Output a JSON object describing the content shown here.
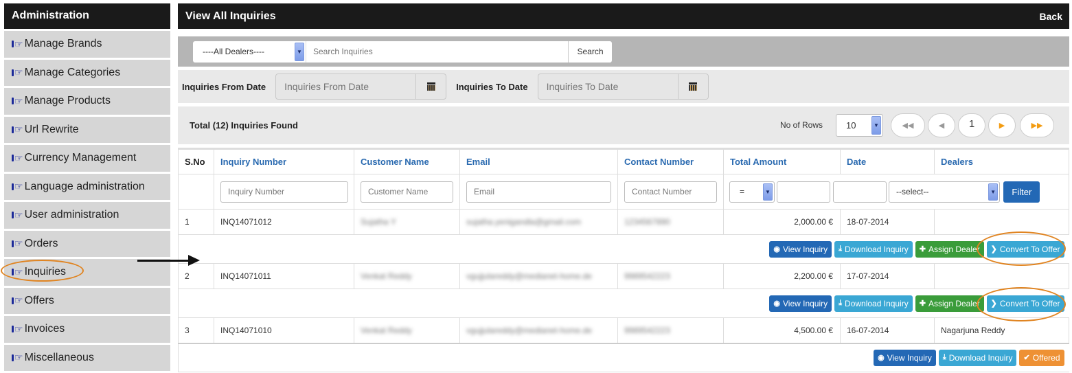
{
  "sidebar": {
    "title": "Administration",
    "items": [
      {
        "label": "Manage Brands"
      },
      {
        "label": "Manage Categories"
      },
      {
        "label": "Manage Products"
      },
      {
        "label": "Url Rewrite"
      },
      {
        "label": "Currency Management"
      },
      {
        "label": "Language administration"
      },
      {
        "label": "User administration"
      },
      {
        "label": "Orders"
      },
      {
        "label": "Inquiries"
      },
      {
        "label": "Offers"
      },
      {
        "label": "Invoices"
      },
      {
        "label": "Miscellaneous"
      }
    ],
    "highlighted_item": "Inquiries"
  },
  "header": {
    "title": "View All Inquiries",
    "back_label": "Back"
  },
  "search": {
    "dealer_select_value": "----All Dealers----",
    "placeholder": "Search Inquiries",
    "button_label": "Search"
  },
  "dates": {
    "from_label": "Inquiries From Date",
    "from_placeholder": "Inquiries From Date",
    "to_label": "Inquiries To Date",
    "to_placeholder": "Inquiries To Date"
  },
  "info": {
    "total_text": "Total (12) Inquiries Found",
    "rows_label": "No of Rows",
    "rows_value": "10",
    "current_page": "1",
    "pager_icons": [
      "first-page-icon",
      "prev-page-icon",
      "next-page-icon",
      "last-page-icon"
    ]
  },
  "table": {
    "headers": [
      "S.No",
      "Inquiry Number",
      "Customer Name",
      "Email",
      "Contact Number",
      "Total Amount",
      "Date",
      "Dealers"
    ],
    "filters": {
      "inquiry_number_placeholder": "Inquiry Number",
      "customer_name_placeholder": "Customer Name",
      "email_placeholder": "Email",
      "contact_number_placeholder": "Contact Number",
      "amount_operator": "=",
      "dealer_select_value": "--select--",
      "filter_button": "Filter"
    },
    "rows": [
      {
        "sno": "1",
        "inquiry_number": "INQ14071012",
        "customer_name": "Sujatha Y",
        "email": "sujatha.yenigandla@gmail.com",
        "contact": "1234567890",
        "amount": "2,000.00 €",
        "date": "18-07-2014",
        "dealer": "",
        "actions": [
          "View Inquiry",
          "Download Inquiry",
          "Assign Dealer",
          "Convert To Offer"
        ]
      },
      {
        "sno": "2",
        "inquiry_number": "INQ14071011",
        "customer_name": "Venkat Reddy",
        "email": "vgujjulareddy@medianet-home.de",
        "contact": "9989542223",
        "amount": "2,200.00 €",
        "date": "17-07-2014",
        "dealer": "",
        "actions": [
          "View Inquiry",
          "Download Inquiry",
          "Assign Dealer",
          "Convert To Offer"
        ]
      },
      {
        "sno": "3",
        "inquiry_number": "INQ14071010",
        "customer_name": "Venkat Reddy",
        "email": "vgujjulareddy@medianet-home.de",
        "contact": "9989542223",
        "amount": "4,500.00 €",
        "date": "16-07-2014",
        "dealer": "Nagarjuna Reddy",
        "actions": [
          "View Inquiry",
          "Download Inquiry",
          "Offered"
        ]
      }
    ]
  },
  "colors": {
    "header_bg": "#1a1a1a",
    "sidebar_item_bg": "#d6d6d6",
    "link_blue": "#2a6ab0",
    "btn_primary": "#2368b5",
    "btn_info": "#3aa7d4",
    "btn_success": "#3a9c3a",
    "btn_warning": "#ee9134",
    "annotation_orange": "#e08421"
  }
}
